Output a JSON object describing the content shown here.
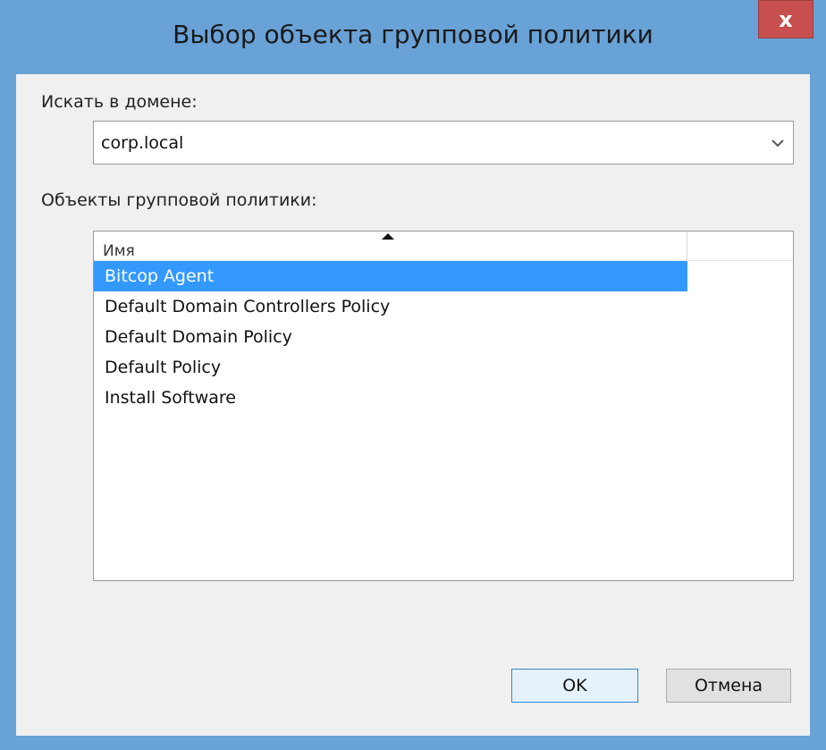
{
  "window": {
    "title": "Выбор объекта групповой политики",
    "close_glyph": "x"
  },
  "domain": {
    "label": "Искать в домене:",
    "value": "corp.local"
  },
  "gpo_list": {
    "label": "Объекты групповой политики:",
    "column_name": "Имя",
    "items": [
      "Bitcop Agent",
      "Default Domain Controllers Policy",
      "Default Domain Policy",
      "Default Policy",
      "Install Software"
    ],
    "selected_index": 0
  },
  "buttons": {
    "ok": "OK",
    "cancel": "Отмена"
  },
  "colors": {
    "frame": "#69a2d6",
    "close": "#c7504f",
    "selection": "#3399ff"
  }
}
